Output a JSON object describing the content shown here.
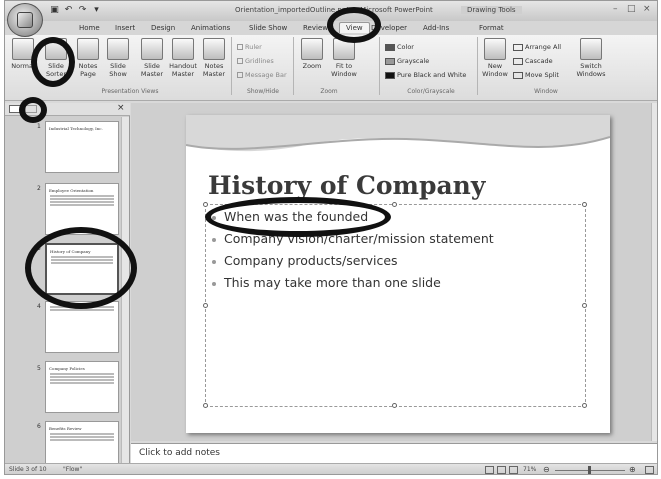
{
  "window": {
    "title": "Orientation_importedOutline.pptx - Microsoft PowerPoint",
    "contextual_tab_group": "Drawing Tools",
    "controls": [
      "–",
      "□",
      "×"
    ]
  },
  "quick_access": [
    "save-icon",
    "undo-icon",
    "redo-icon",
    "dropdown-icon"
  ],
  "tabs": [
    "Home",
    "Insert",
    "Design",
    "Animations",
    "Slide Show",
    "Review",
    "View",
    "Developer",
    "Add-Ins",
    "Format"
  ],
  "active_tab": "View",
  "ribbon": {
    "presentation_views": {
      "label": "Presentation Views",
      "buttons": [
        {
          "line1": "Normal",
          "line2": ""
        },
        {
          "line1": "Slide",
          "line2": "Sorter"
        },
        {
          "line1": "Notes",
          "line2": "Page"
        },
        {
          "line1": "Slide",
          "line2": "Show"
        },
        {
          "line1": "Slide",
          "line2": "Master"
        },
        {
          "line1": "Handout",
          "line2": "Master"
        },
        {
          "line1": "Notes",
          "line2": "Master"
        }
      ]
    },
    "show_hide": {
      "label": "Show/Hide",
      "items": [
        "Ruler",
        "Gridlines",
        "Message Bar"
      ]
    },
    "zoom": {
      "label": "Zoom",
      "buttons": [
        {
          "line1": "Zoom",
          "line2": ""
        },
        {
          "line1": "Fit to",
          "line2": "Window"
        }
      ]
    },
    "color_grayscale": {
      "label": "Color/Grayscale",
      "items": [
        "Color",
        "Grayscale",
        "Pure Black and White"
      ]
    },
    "window": {
      "label": "Window",
      "new_window": {
        "line1": "New",
        "line2": "Window"
      },
      "items": [
        "Arrange All",
        "Cascade",
        "Move Split"
      ],
      "switch": {
        "line1": "Switch",
        "line2": "Windows"
      }
    }
  },
  "slides_pane": {
    "close": "×",
    "thumbnails": [
      {
        "number": "1",
        "title": "Industrial Technology, Inc."
      },
      {
        "number": "2",
        "title": "Employee Orientation"
      },
      {
        "number": "3",
        "title": "History of Company"
      },
      {
        "number": "4",
        "title": ""
      },
      {
        "number": "5",
        "title": "Company Policies"
      },
      {
        "number": "6",
        "title": "Benefits Review"
      }
    ]
  },
  "slide": {
    "title": "History of Company",
    "bullets": [
      "When was the founded",
      "Company vision/charter/mission statement",
      "Company products/services",
      "This may take more than one slide"
    ]
  },
  "notes": {
    "placeholder": "Click to add notes"
  },
  "status_bar": {
    "slide_info": "Slide 3 of 10",
    "theme": "\"Flow\"",
    "zoom_level": "71%"
  },
  "colors": {
    "annotation": "#111111",
    "ribbon": "#e6e6e6",
    "slide_title": "#3a3a3a"
  }
}
